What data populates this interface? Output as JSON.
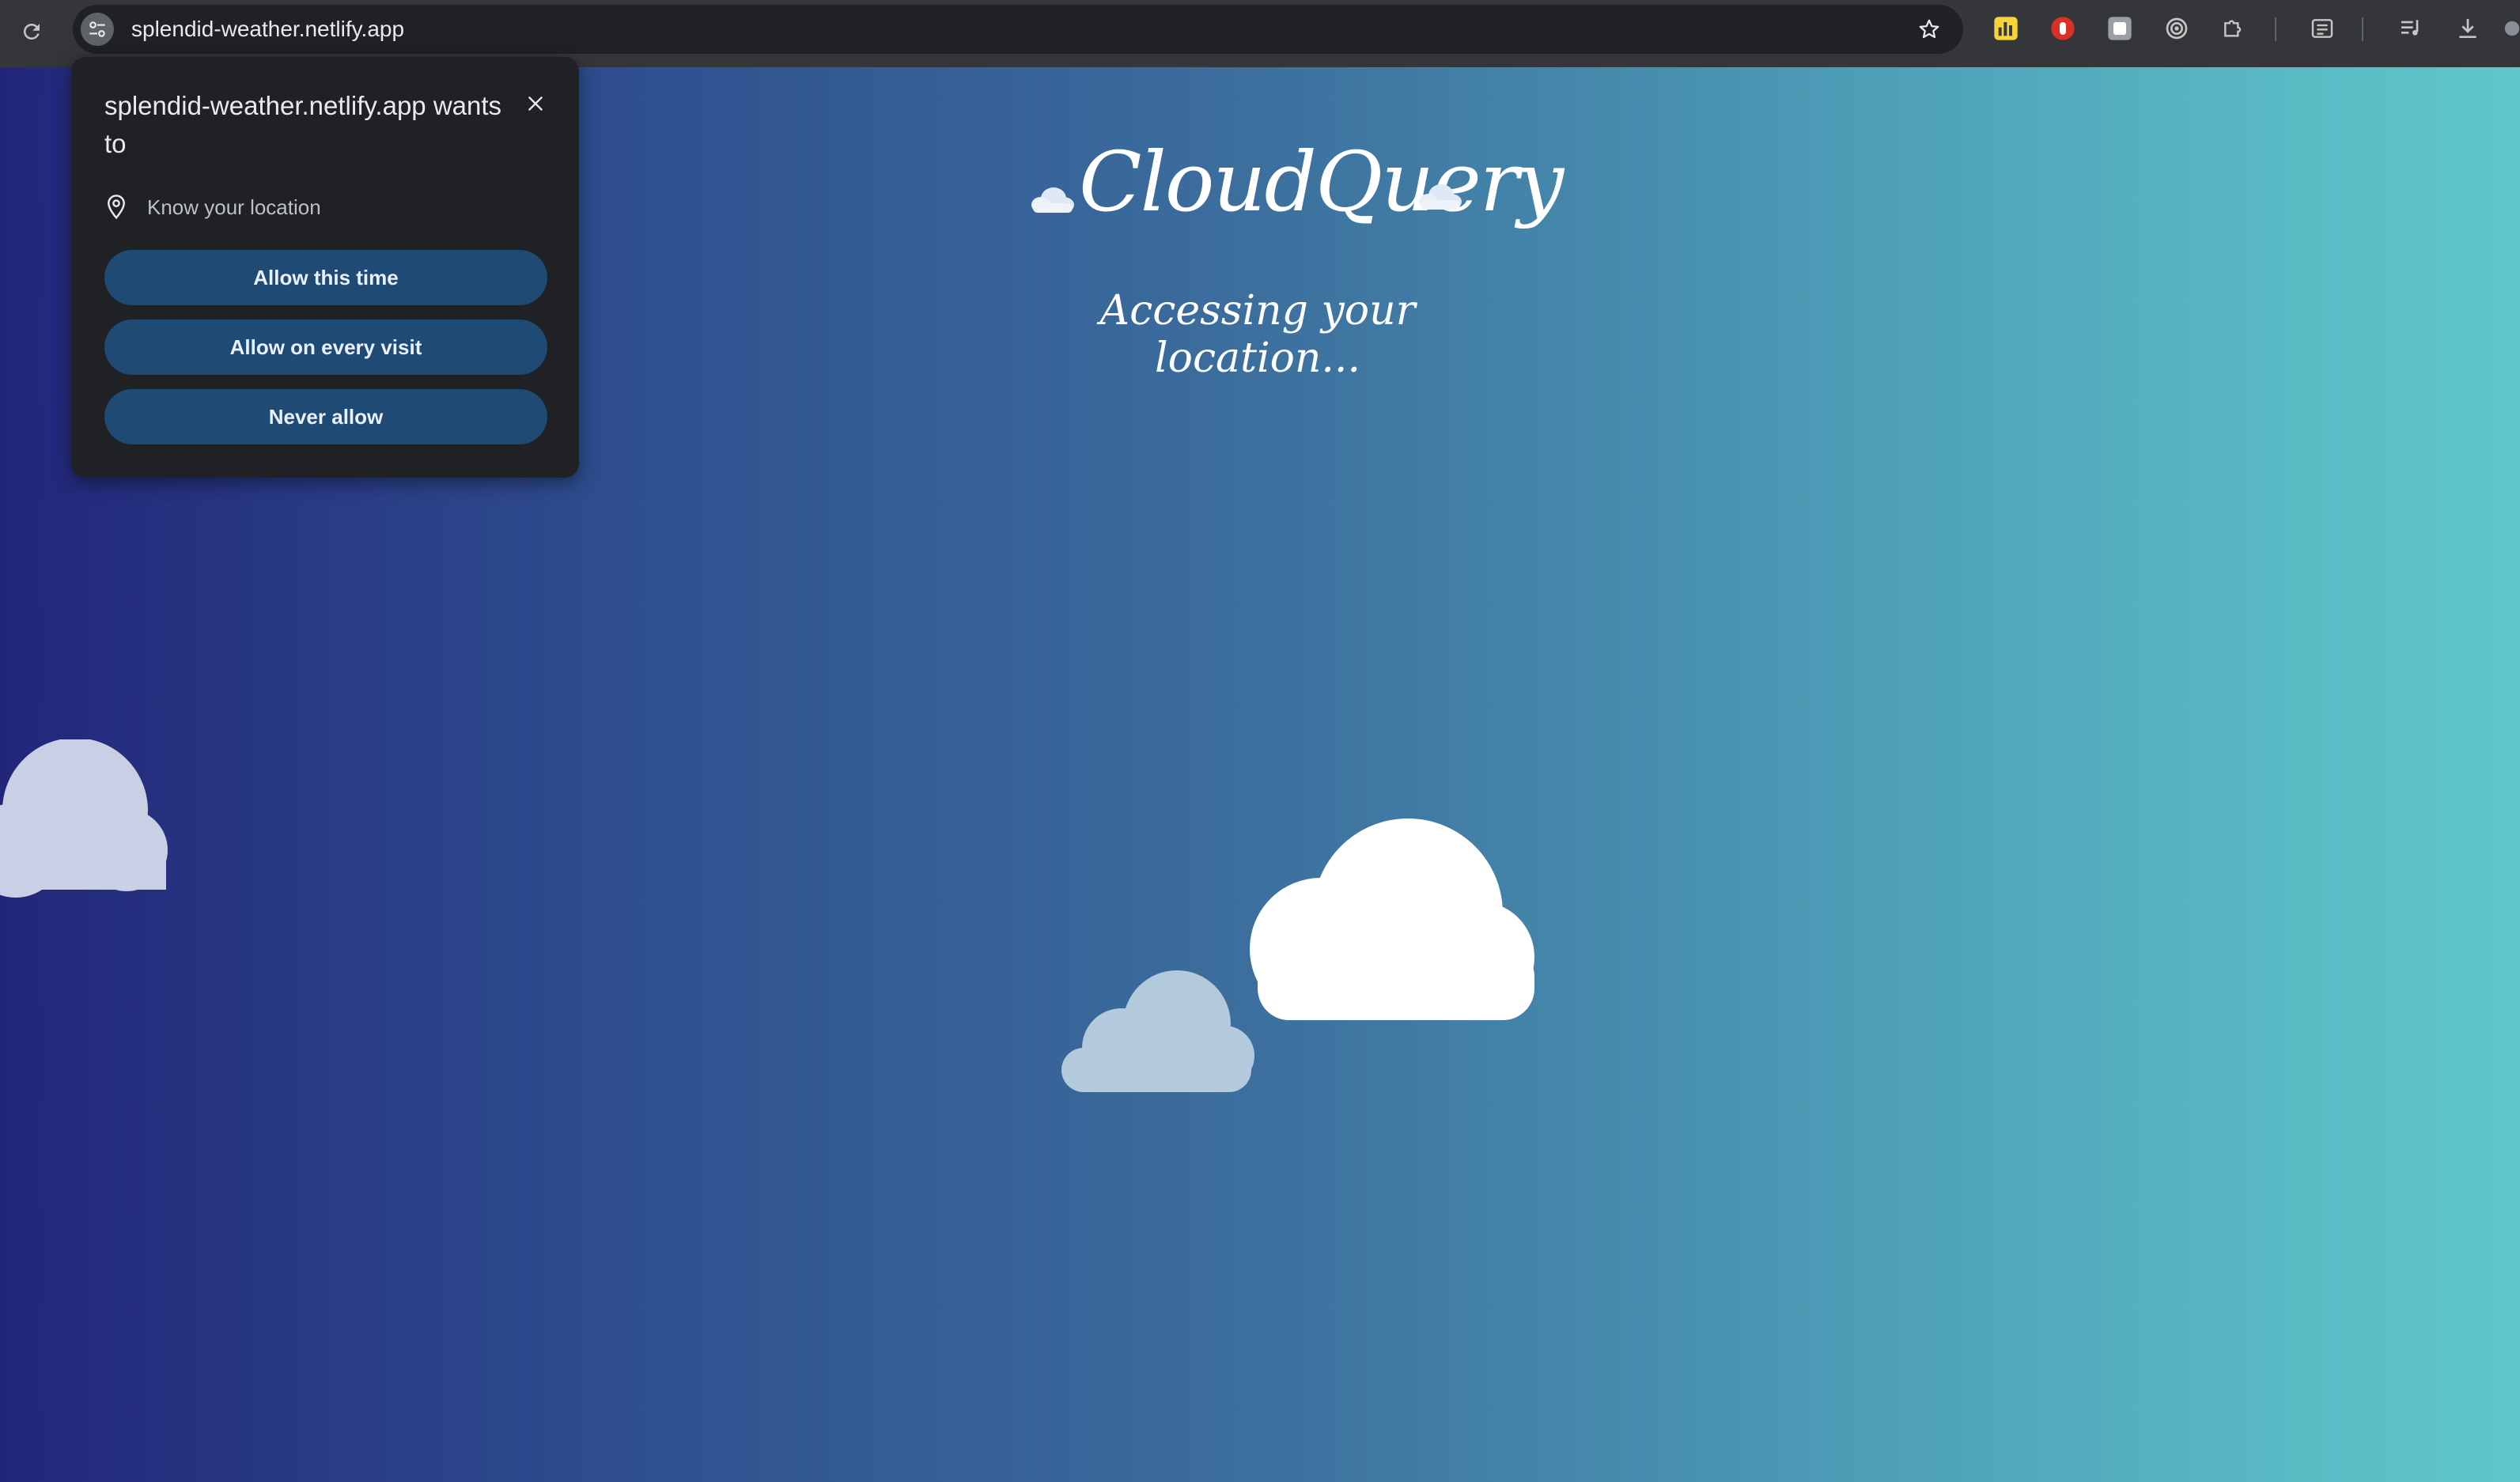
{
  "browser": {
    "url": "splendid-weather.netlify.app",
    "icons": {
      "reload": "reload-icon",
      "site_info": "tune-icon",
      "bookmark": "star-icon",
      "extensions": [
        "chart-extension-icon",
        "stop-hand-extension-icon",
        "puzzle-tile-extension-icon",
        "target-extension-icon",
        "puzzle-icon",
        "reading-list-icon",
        "media-queue-icon",
        "download-icon"
      ]
    }
  },
  "page": {
    "app_name": "CloudQuery",
    "status": "Accessing your location...",
    "colors": {
      "gradient_start": "#22267a",
      "gradient_end": "#5fc8cb",
      "cloud_white": "#ffffff",
      "cloud_light": "#c9d0e6",
      "cloud_blue": "#b3c9dc"
    }
  },
  "permission_popup": {
    "title": "splendid-weather.netlify.app wants to",
    "permission": "Know your location",
    "buttons": {
      "allow_once": "Allow this time",
      "allow_always": "Allow on every visit",
      "never": "Never allow"
    },
    "button_color": "#1e4a74"
  }
}
